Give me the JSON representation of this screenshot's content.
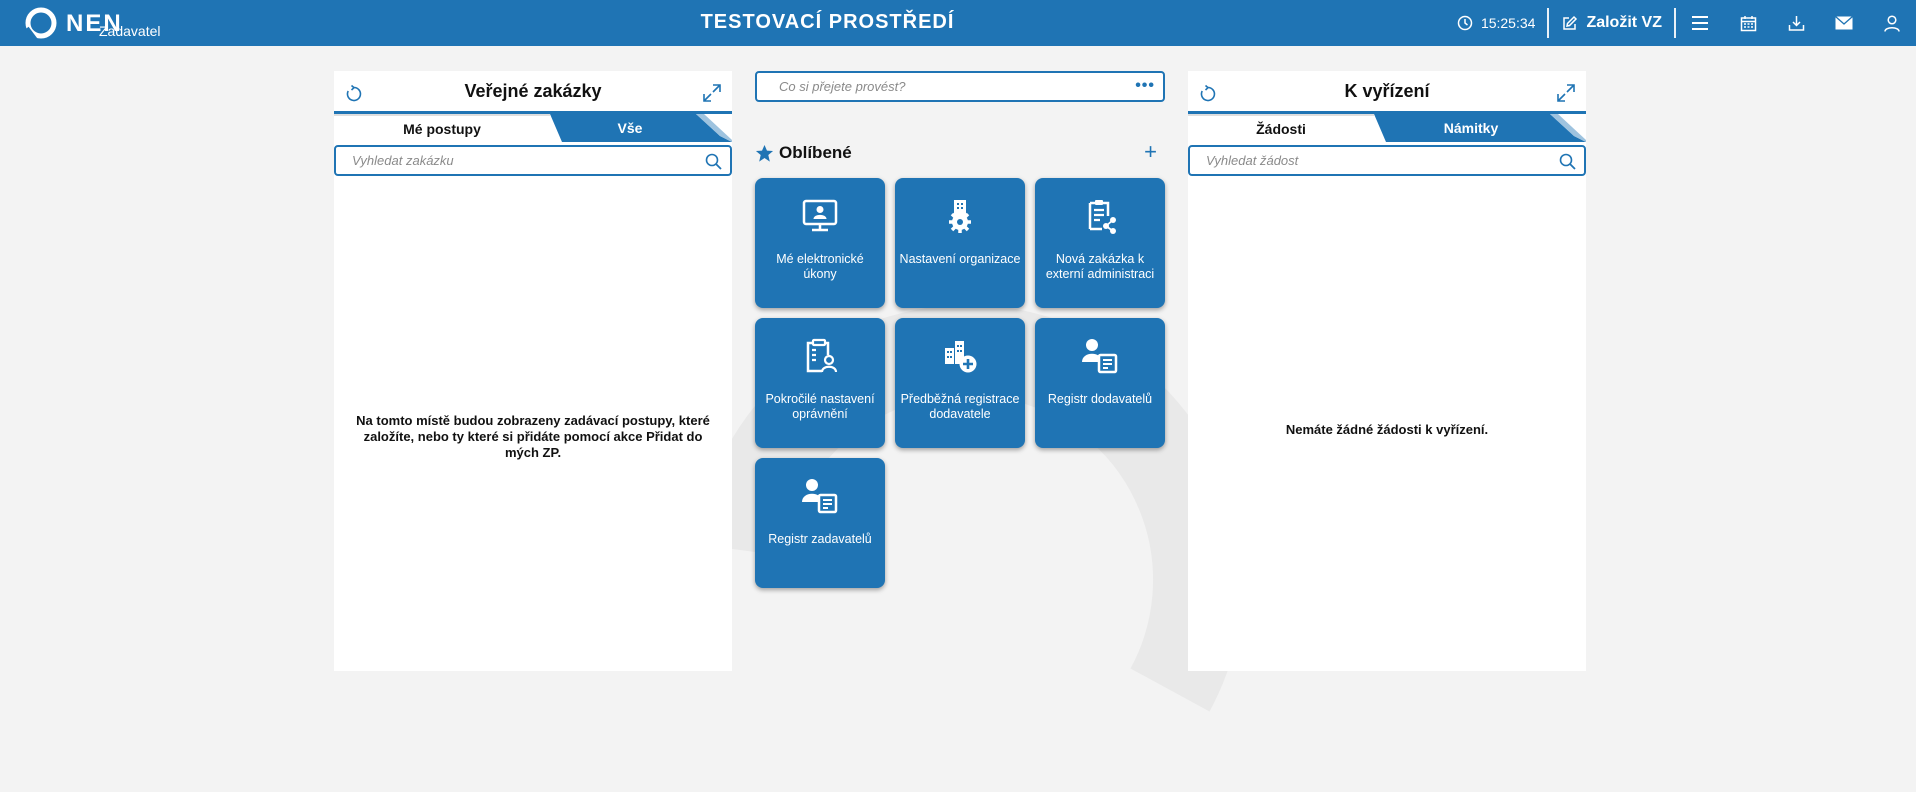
{
  "topbar": {
    "logo_text": "NEN",
    "logo_sub": "Zadavatel",
    "env_title": "TESTOVACÍ PROSTŘEDÍ",
    "clock": "15:25:34",
    "create_label": "Založit VZ",
    "icons": [
      "clock-icon",
      "edit-icon",
      "menu-icon",
      "calendar-icon",
      "download-icon",
      "mail-icon",
      "user-icon"
    ]
  },
  "left_panel": {
    "title": "Veřejné zakázky",
    "tab_active": "Mé postupy",
    "tab_inactive": "Vše",
    "search_placeholder": "Vyhledat zakázku",
    "empty_message": "Na tomto místě budou zobrazeny zadávací postupy, které založíte, nebo ty které si přidáte pomocí akce Přidat do mých ZP."
  },
  "center": {
    "command_placeholder": "Co si přejete provést?",
    "command_more": "•••",
    "favorites_title": "Oblíbené",
    "add_symbol": "+",
    "tiles": [
      {
        "label": "Mé elektronické úkony",
        "icon": "monitor-user-icon"
      },
      {
        "label": "Nastavení organizace",
        "icon": "building-gear-icon"
      },
      {
        "label": "Nová zakázka k externí administraci",
        "icon": "clipboard-share-icon"
      },
      {
        "label": "Pokročilé nastavení oprávnění",
        "icon": "clipboard-user-icon"
      },
      {
        "label": "Předběžná registrace dodavatele",
        "icon": "building-add-icon"
      },
      {
        "label": "Registr dodavatelů",
        "icon": "user-card-icon"
      },
      {
        "label": "Registr zadavatelů",
        "icon": "user-card-icon"
      }
    ]
  },
  "right_panel": {
    "title": "K vyřízení",
    "tab_active": "Žádosti",
    "tab_inactive": "Námitky",
    "search_placeholder": "Vyhledat žádost",
    "empty_message": "Nemáte žádné žádosti k vyřízení."
  },
  "colors": {
    "brand": "#1f74b4",
    "background": "#f3f3f3",
    "panel": "#ffffff"
  }
}
